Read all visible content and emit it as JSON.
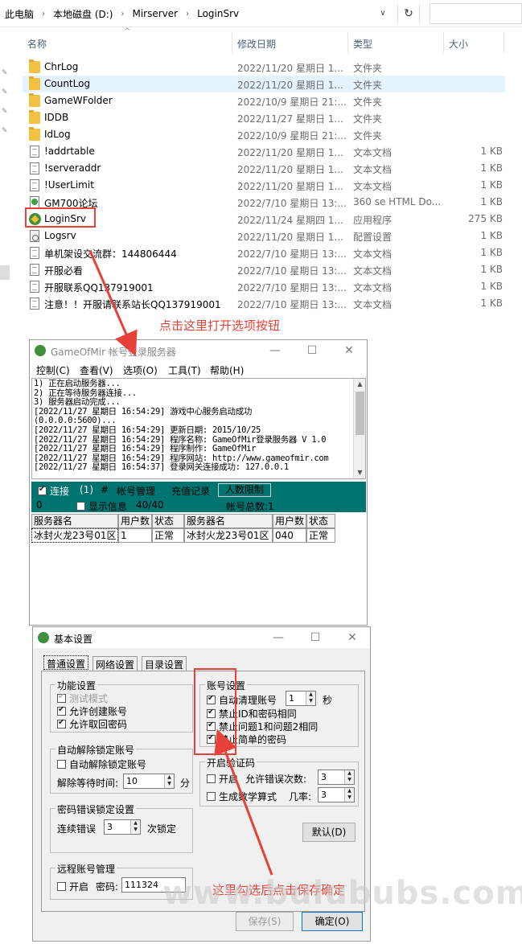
{
  "explorer": {
    "breadcrumb": [
      "此电脑",
      "本地磁盘 (D:)",
      "Mirserver",
      "LoginSrv"
    ],
    "columns": {
      "name": "名称",
      "date": "修改日期",
      "type": "类型",
      "size": "大小"
    },
    "files": [
      {
        "icon": "folder-icon",
        "name": "ChrLog",
        "date": "2022/11/20 星期日 1...",
        "type": "文件夹",
        "size": ""
      },
      {
        "icon": "folder-icon",
        "name": "CountLog",
        "date": "2022/11/20 星期日 1...",
        "type": "文件夹",
        "size": "",
        "selected": true
      },
      {
        "icon": "folder-icon",
        "name": "GameWFolder",
        "date": "2022/10/9 星期日 21:...",
        "type": "文件夹",
        "size": ""
      },
      {
        "icon": "folder-icon",
        "name": "IDDB",
        "date": "2022/11/27 星期日 1...",
        "type": "文件夹",
        "size": ""
      },
      {
        "icon": "folder-icon",
        "name": "IdLog",
        "date": "2022/10/9 星期日 21:...",
        "type": "文件夹",
        "size": ""
      },
      {
        "icon": "document-icon",
        "name": "!addrtable",
        "date": "2022/11/20 星期日 1...",
        "type": "文本文档",
        "size": "1 KB"
      },
      {
        "icon": "document-icon",
        "name": "!serveraddr",
        "date": "2022/11/20 星期日 1...",
        "type": "文本文档",
        "size": "1 KB"
      },
      {
        "icon": "document-icon",
        "name": "!UserLimit",
        "date": "2022/11/20 星期日 1...",
        "type": "文本文档",
        "size": "1 KB"
      },
      {
        "icon": "html-icon",
        "name": "GM700论坛",
        "date": "2022/7/10 星期日 13:...",
        "type": "360 se HTML Do...",
        "size": "1 KB"
      },
      {
        "icon": "app-icon",
        "name": "LoginSrv",
        "date": "2022/11/24 星期四 1...",
        "type": "应用程序",
        "size": "275 KB"
      },
      {
        "icon": "config-icon",
        "name": "Logsrv",
        "date": "2022/11/20 星期日 1...",
        "type": "配置设置",
        "size": "1 KB"
      },
      {
        "icon": "document-icon",
        "name": "单机架设交流群：144806444",
        "date": "2022/7/10 星期日 13:...",
        "type": "文本文档",
        "size": "1 KB"
      },
      {
        "icon": "document-icon",
        "name": "开服必看",
        "date": "2022/7/10 星期日 13:...",
        "type": "文本文档",
        "size": "1 KB"
      },
      {
        "icon": "document-icon",
        "name": "开服联系QQ137919001",
        "date": "2022/7/10 星期日 13:...",
        "type": "文本文档",
        "size": "1 KB"
      },
      {
        "icon": "document-icon",
        "name": "注意！！开服请联系站长QQ137919001",
        "date": "2022/7/10 星期日 13:...",
        "type": "文本文档",
        "size": "1 KB"
      }
    ]
  },
  "annotations": {
    "open_options": "点击这里打开选项按钮",
    "save_hint": "这里勾选后点击保存确定"
  },
  "server_window": {
    "title": "GameOfMir 帐号登录服务器",
    "menu": [
      "控制(C)",
      "查看(V)",
      "选项(O)",
      "工具(T)",
      "帮助(H)"
    ],
    "log": [
      "1) 正在启动服务器...",
      "2) 正在等待服务器连接...",
      "3) 服务器启动完成...",
      "[2022/11/27 星期日 16:54:29] 游戏中心服务启动成功",
      "(0.0.0.0:5600)...",
      "[2022/11/27 星期日 16:54:29] 更新日期: 2015/10/25",
      "[2022/11/27 星期日 16:54:29] 程序名称: GameOfMir登录服务器 V 1.0",
      "[2022/11/27 星期日 16:54:29] 程序制作: GameOfMir",
      "[2022/11/27 星期日 16:54:29] 程序网站: http://www.gameofmir.com",
      "[2022/11/27 星期日 16:54:37] 登录网关连接成功: 127.0.0.1"
    ],
    "status": {
      "connect_label": "连接",
      "connect_count": "(1)",
      "hash": "#",
      "account_mgmt": "帐号管理",
      "recharge": "充值记录",
      "limit": "人数限制",
      "zero": "0",
      "show_info": "显示信息",
      "ratio": "40/40",
      "total": "帐号总数:1"
    },
    "grid": {
      "headers": [
        "服务器名",
        "用户数",
        "状态",
        "服务器名",
        "用户数",
        "状态"
      ],
      "row": [
        "冰封火龙23号01区",
        "1",
        "正常",
        "冰封火龙23号01区",
        "040",
        "正常"
      ]
    }
  },
  "settings_dialog": {
    "title": "基本设置",
    "tabs": [
      "普通设置",
      "网络设置",
      "目录设置"
    ],
    "function_group": {
      "title": "功能设置",
      "test_mode": "测试模式",
      "allow_create": "允许创建账号",
      "allow_recover": "允许取回密码"
    },
    "auto_unlock": {
      "title": "自动解除锁定账号",
      "option": "自动解除锁定账号",
      "wait_label": "解除等待时间:",
      "wait_value": "10",
      "unit": "分"
    },
    "pwd_error": {
      "title": "密码错误锁定设置",
      "prefix": "连续错误",
      "value": "3",
      "suffix": "次锁定"
    },
    "remote": {
      "title": "远程账号管理",
      "enable": "开启",
      "pwd_label": "密码:",
      "pwd_value": "111324"
    },
    "account": {
      "title": "账号设置",
      "auto_clean": "自动清理账号",
      "auto_clean_value": "1",
      "seconds": "秒",
      "ban_id_pwd": "禁止ID和密码相同",
      "ban_q1_q2": "禁止问题1和问题2相同",
      "ban_simple": "禁止简单的密码"
    },
    "captcha": {
      "title": "开启验证码",
      "enable": "开启",
      "allow_err": "允许错误次数:",
      "allow_err_value": "3",
      "math": "生成数学算式",
      "prob": "几率:",
      "prob_value": "3"
    },
    "buttons": {
      "default": "默认(D)",
      "save": "保存(S)",
      "ok": "确定(O)"
    }
  },
  "watermark": "www.bulububs.com",
  "colors": {
    "accent_red": "#e8413a",
    "teal": "#007470",
    "selection": "#e5f3ff"
  }
}
